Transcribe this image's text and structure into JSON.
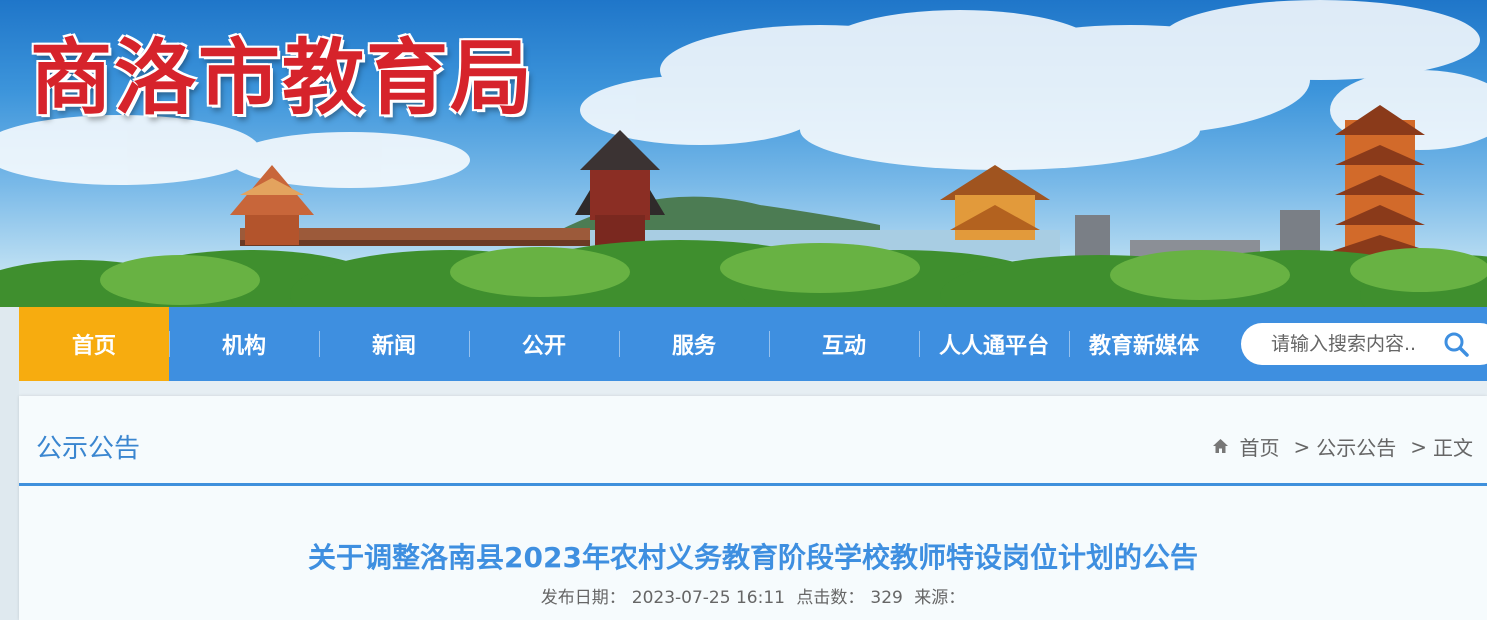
{
  "header": {
    "site_title": "商洛市教育局"
  },
  "nav": {
    "items": [
      {
        "label": "首页",
        "active": true
      },
      {
        "label": "机构",
        "active": false
      },
      {
        "label": "新闻",
        "active": false
      },
      {
        "label": "公开",
        "active": false
      },
      {
        "label": "服务",
        "active": false
      },
      {
        "label": "互动",
        "active": false
      },
      {
        "label": "人人通平台",
        "active": false
      },
      {
        "label": "教育新媒体",
        "active": false
      }
    ],
    "search_placeholder": "请输入搜索内容..",
    "search_icon": "search-icon"
  },
  "section": {
    "title": "公示公告"
  },
  "breadcrumb": {
    "home_icon": "home-icon",
    "items": [
      "首页",
      "公示公告",
      "正文"
    ],
    "separator": ">"
  },
  "article": {
    "title": "关于调整洛南县2023年农村义务教育阶段学校教师特设岗位计划的公告",
    "date_label": "发布日期：",
    "date_value": "2023-07-25 16:11",
    "clicks_label": "点击数：",
    "clicks_value": "329",
    "source_label": "来源："
  },
  "colors": {
    "nav_bg": "#3e8fe0",
    "nav_active": "#f7ac0f",
    "title_red": "#d6232b",
    "accent_blue": "#3a86d0"
  }
}
